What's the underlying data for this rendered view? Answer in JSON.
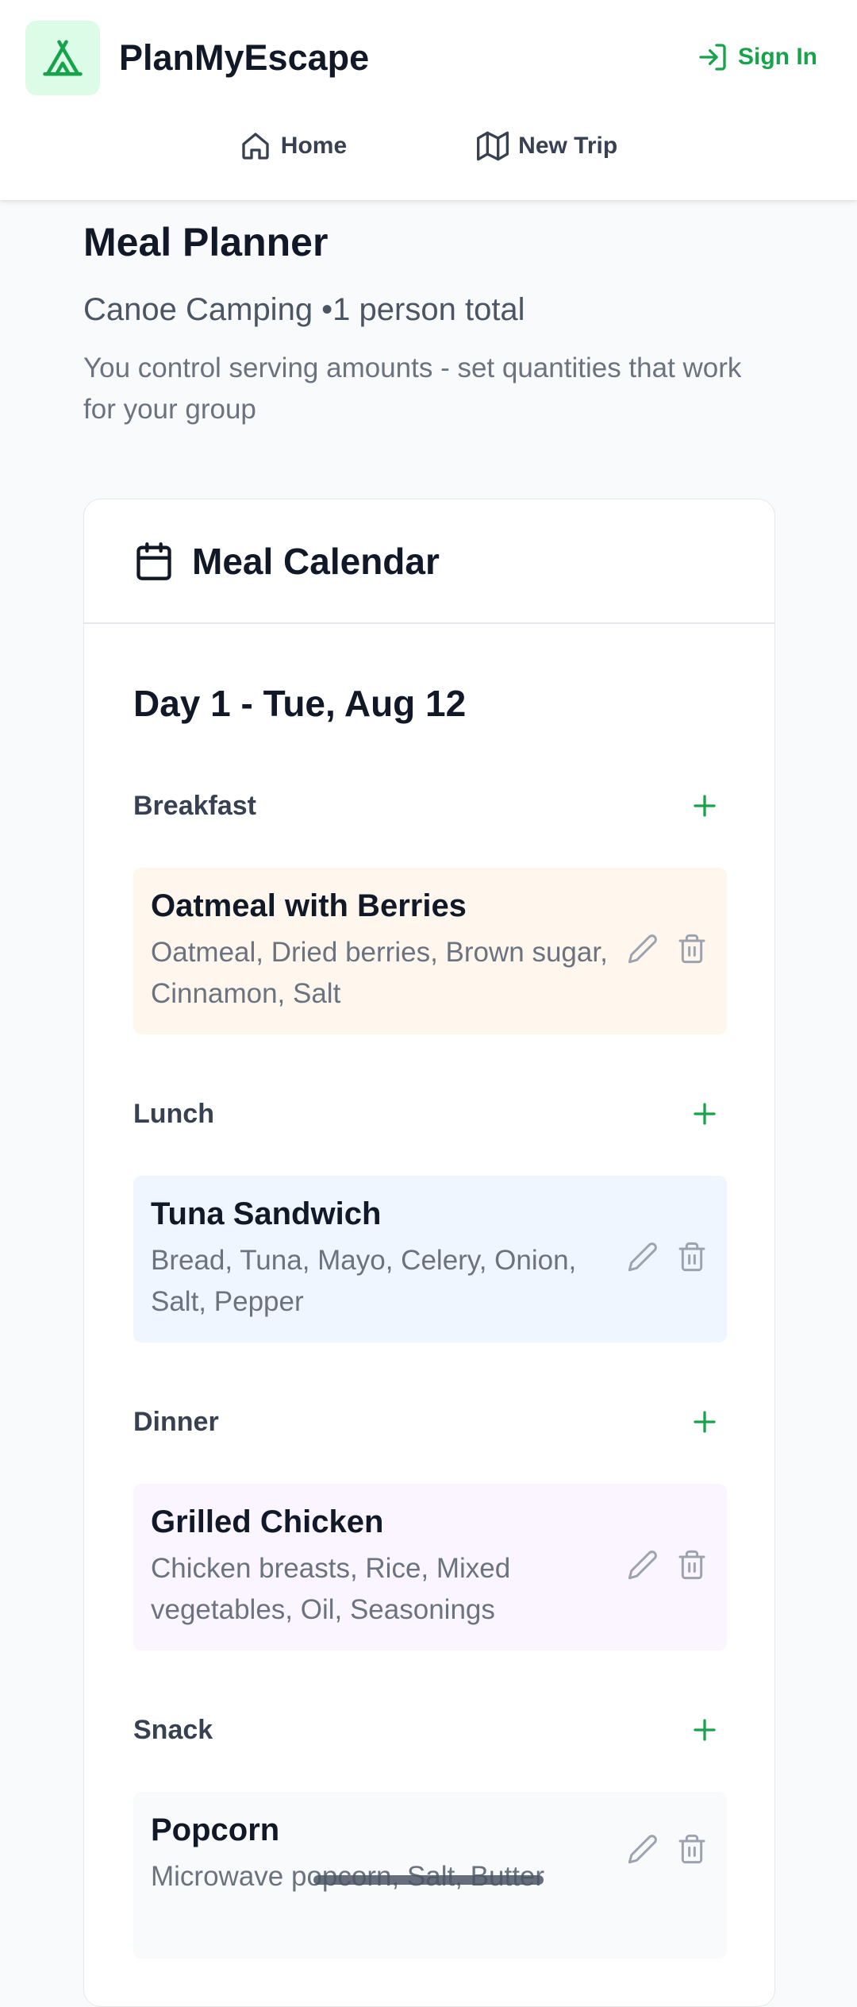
{
  "app": {
    "name": "PlanMyEscape",
    "logo_icon": "tent-icon",
    "accent_color": "#16a34a",
    "sign_in_label": "Sign In"
  },
  "nav": {
    "home_label": "Home",
    "new_trip_label": "New Trip"
  },
  "page": {
    "title": "Meal Planner",
    "subtitle": "Canoe Camping •1 person total",
    "note": "You control serving amounts - set quantities that work for your group"
  },
  "calendar": {
    "title": "Meal Calendar",
    "day_title": "Day 1 - Tue, Aug 12",
    "meals": [
      {
        "label": "Breakfast",
        "name": "Oatmeal with Berries",
        "ingredients": "Oatmeal, Dried berries, Brown sugar, Cinnamon, Salt",
        "bg_color": "#fff7ed"
      },
      {
        "label": "Lunch",
        "name": "Tuna Sandwich",
        "ingredients": "Bread, Tuna, Mayo, Celery, Onion, Salt, Pepper",
        "bg_color": "#eff6ff"
      },
      {
        "label": "Dinner",
        "name": "Grilled Chicken",
        "ingredients": "Chicken breasts, Rice, Mixed vegetables, Oil, Seasonings",
        "bg_color": "#faf5ff"
      },
      {
        "label": "Snack",
        "name": "Popcorn",
        "ingredients": "Microwave popcorn, Salt, Butter",
        "bg_color": "#f9fafb"
      }
    ]
  }
}
